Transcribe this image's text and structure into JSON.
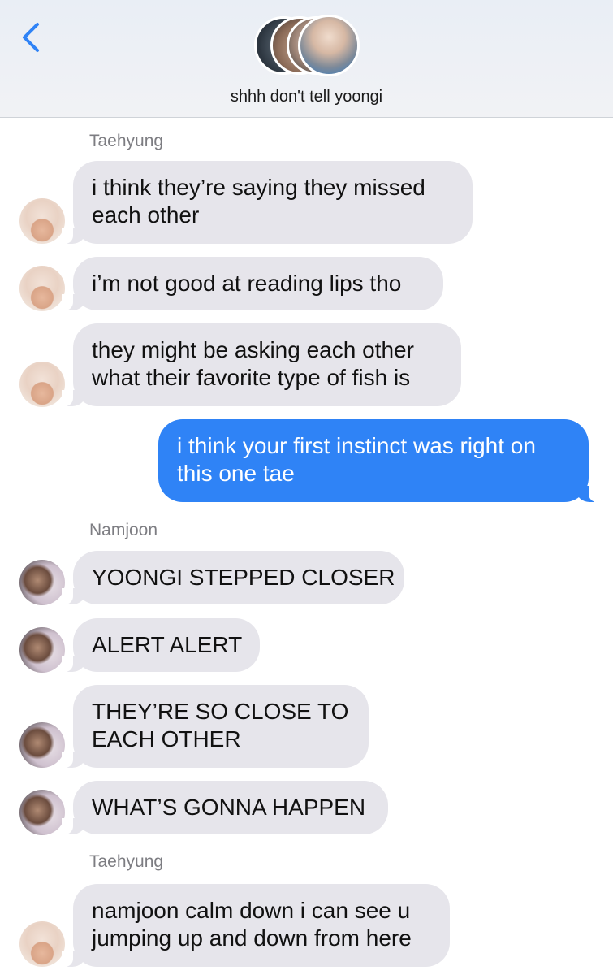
{
  "header": {
    "title": "shhh don't tell yoongi",
    "back_icon": "chevron-left-icon",
    "accent_color": "#2f83f6"
  },
  "messages": [
    {
      "type": "sender",
      "text": "Taehyung"
    },
    {
      "type": "in",
      "from": "Taehyung",
      "lines": [
        "i think they’re saying they missed",
        "each other"
      ]
    },
    {
      "type": "in",
      "from": "Taehyung",
      "lines": [
        "i’m not good at reading lips tho"
      ]
    },
    {
      "type": "in",
      "from": "Taehyung",
      "lines": [
        "they might be asking each other",
        "what their favorite type of fish is"
      ]
    },
    {
      "type": "out",
      "lines": [
        "i think your first instinct was right on",
        "this one tae"
      ]
    },
    {
      "type": "sender",
      "text": "Namjoon"
    },
    {
      "type": "in",
      "from": "Namjoon",
      "lines": [
        "YOONGI STEPPED CLOSER"
      ]
    },
    {
      "type": "in",
      "from": "Namjoon",
      "lines": [
        "ALERT ALERT"
      ]
    },
    {
      "type": "in",
      "from": "Namjoon",
      "lines": [
        "THEY’RE SO CLOSE TO",
        "EACH OTHER"
      ]
    },
    {
      "type": "in",
      "from": "Namjoon",
      "lines": [
        "WHAT’S GONNA HAPPEN"
      ]
    },
    {
      "type": "sender",
      "text": "Taehyung"
    },
    {
      "type": "in",
      "from": "Taehyung",
      "lines": [
        "namjoon calm down i can see u",
        "jumping up and down from here"
      ]
    }
  ]
}
